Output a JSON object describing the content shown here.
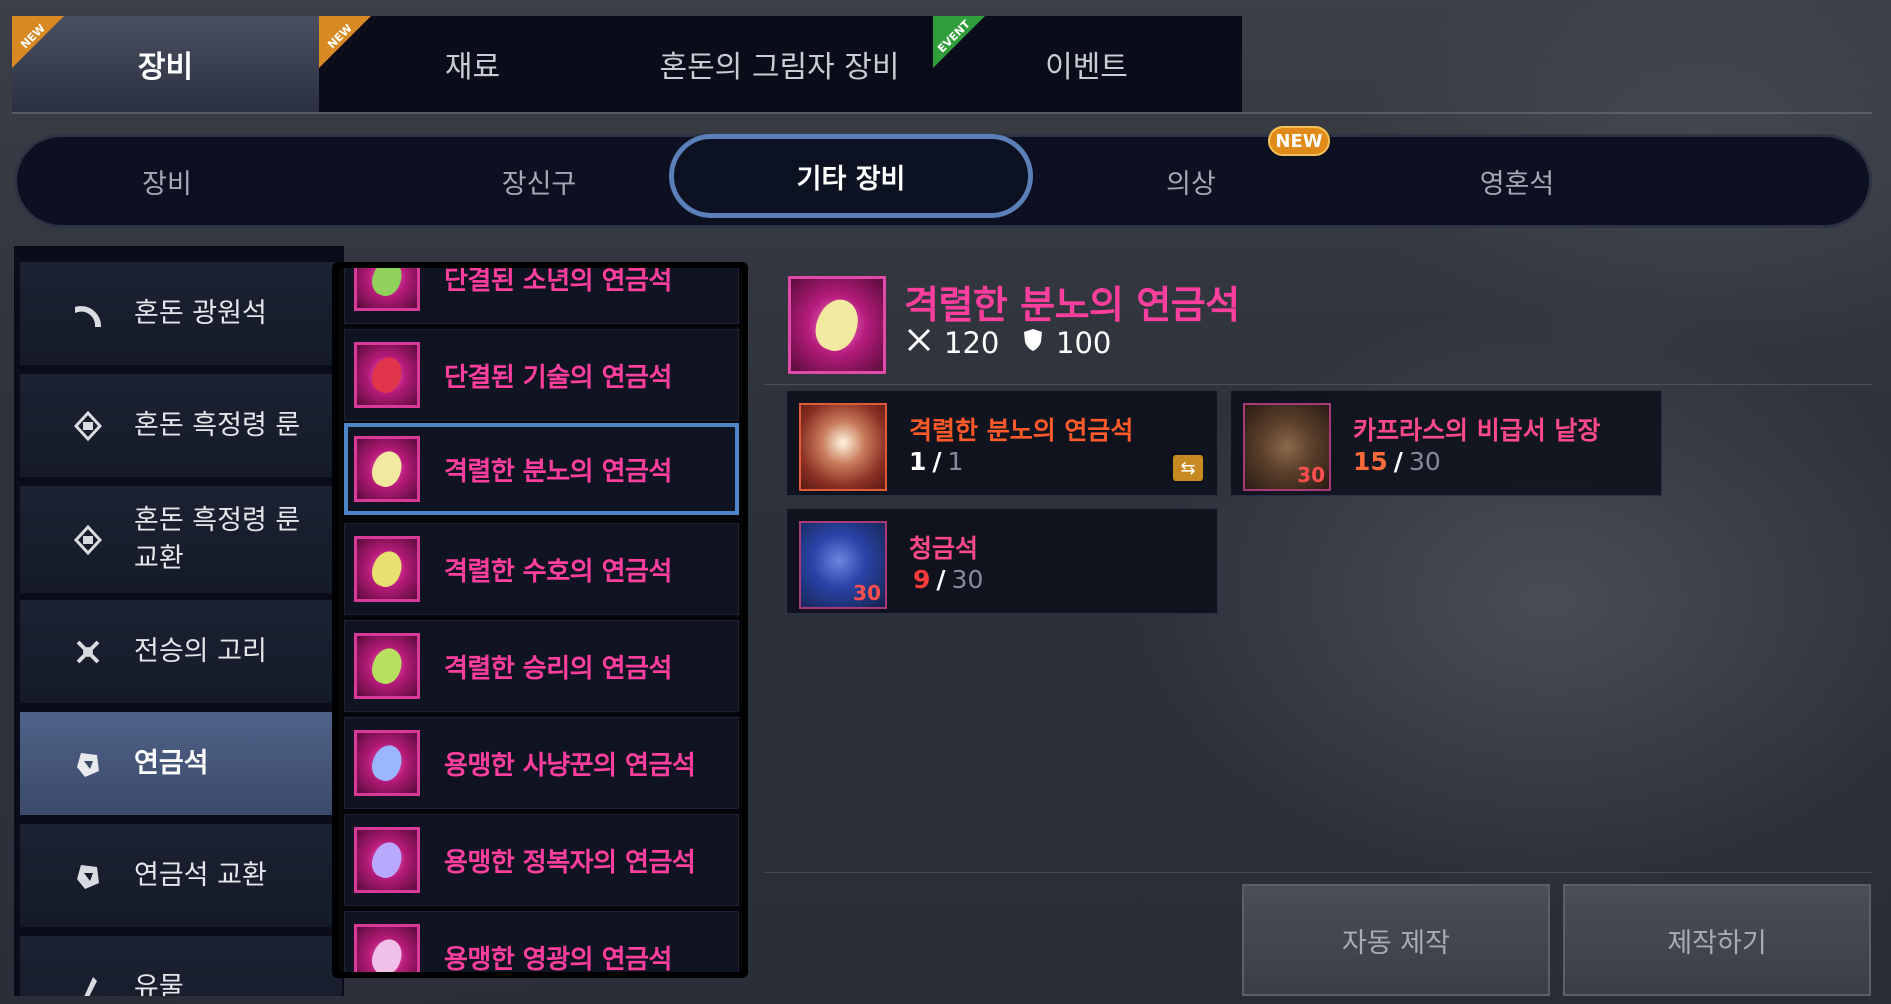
{
  "top_tabs": [
    {
      "label": "장비",
      "badge": "NEW",
      "active": true
    },
    {
      "label": "재료",
      "badge": "NEW",
      "active": false
    },
    {
      "label": "혼돈의 그림자 장비",
      "badge": "",
      "active": false
    },
    {
      "label": "이벤트",
      "badge": "EVENT",
      "active": false
    }
  ],
  "sub_tabs": [
    {
      "label": "장비"
    },
    {
      "label": "장신구"
    },
    {
      "label": "기타 장비",
      "active": true
    },
    {
      "label": "의상",
      "badge": "NEW"
    },
    {
      "label": "영혼석"
    }
  ],
  "categories": [
    {
      "label": "혼돈 광원석",
      "icon": "crescent-icon"
    },
    {
      "label": "혼돈 흑정령 룬",
      "icon": "rune-icon"
    },
    {
      "label": "혼돈 흑정령 룬 교환",
      "icon": "rune-exchange-icon"
    },
    {
      "label": "전승의 고리",
      "icon": "ring-icon"
    },
    {
      "label": "연금석",
      "icon": "alchemy-stone-icon",
      "active": true
    },
    {
      "label": "연금석 교환",
      "icon": "alchemy-exchange-icon"
    },
    {
      "label": "유물",
      "icon": "relic-icon"
    }
  ],
  "items": [
    {
      "label": "단결된 소년의 연금석",
      "gem_color": "#8fd15a"
    },
    {
      "label": "단결된 기술의 연금석",
      "gem_color": "#e0344a"
    },
    {
      "label": "격렬한 분노의 연금석",
      "gem_color": "#f2e9a0",
      "selected": true
    },
    {
      "label": "격렬한 수호의 연금석",
      "gem_color": "#e8e070"
    },
    {
      "label": "격렬한 승리의 연금석",
      "gem_color": "#b8e060"
    },
    {
      "label": "용맹한 사냥꾼의 연금석",
      "gem_color": "#9ab6ff"
    },
    {
      "label": "용맹한 정복자의 연금석",
      "gem_color": "#b9a8ff"
    },
    {
      "label": "용맹한 영광의 연금석",
      "gem_color": "#f0c0e8"
    }
  ],
  "detail": {
    "title": "격렬한 분노의 연금석",
    "attack": "120",
    "defense": "100"
  },
  "materials": [
    {
      "name": "격렬한 분노의 연금석",
      "have": "1",
      "need": "1",
      "badge": "",
      "name_color": "orange",
      "have_red": false
    },
    {
      "name": "카프라스의 비급서 낱장",
      "have": "15",
      "need": "30",
      "badge": "30",
      "name_color": "pink",
      "have_red": true
    },
    {
      "name": "청금석",
      "have": "9",
      "need": "30",
      "badge": "30",
      "name_color": "pink",
      "have_red": true
    }
  ],
  "buttons": {
    "auto_craft": "자동 제작",
    "craft": "제작하기"
  },
  "sep": "/"
}
